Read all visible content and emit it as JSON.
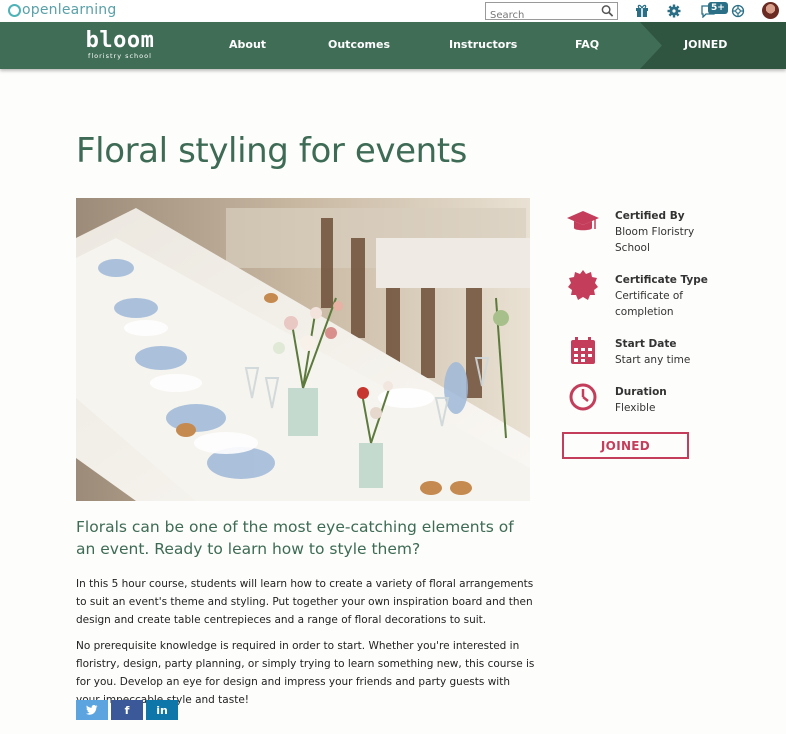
{
  "topbar": {
    "logo_text": "openlearning",
    "search_placeholder": "Search",
    "notifications_badge": "5+",
    "icons": [
      "gift-icon",
      "gear-icon",
      "chat-icon",
      "help-icon",
      "avatar"
    ]
  },
  "nav": {
    "brand_name": "bloom",
    "brand_sub": "floristry school",
    "items": [
      {
        "label": "About"
      },
      {
        "label": "Outcomes"
      },
      {
        "label": "Instructors"
      },
      {
        "label": "FAQ"
      }
    ],
    "joined_label": "JOINED"
  },
  "main": {
    "title": "Floral styling for events",
    "intro": "Florals can be one of the most eye-catching elements of an event. Ready to learn how to style them?",
    "paragraph1": "In this 5 hour course, students will learn how to create a variety of floral arrangements to suit an event's theme and styling. Put together your own inspiration board and then design and create table centrepieces and a range of floral decorations to suit.",
    "paragraph2": "No prerequisite knowledge is required in order to start. Whether you're interested in floristry, design, party planning, or simply trying to learn something new, this course is for you.  Develop an eye for design and impress your friends and party guests with your impeccable style and taste!",
    "share": [
      {
        "icon": "twitter-icon",
        "color": "#5ba4e0"
      },
      {
        "label": "f",
        "icon": "facebook-icon",
        "color": "#3b5998"
      },
      {
        "label": "in",
        "icon": "linkedin-icon",
        "color": "#0e76a8"
      }
    ]
  },
  "sidebar": {
    "facts": [
      {
        "label": "Certified By",
        "value": "Bloom Floristry School",
        "icon": "graduation-cap-icon"
      },
      {
        "label": "Certificate Type",
        "value": "Certificate of completion",
        "icon": "certificate-seal-icon"
      },
      {
        "label": "Start Date",
        "value": "Start any time",
        "icon": "calendar-icon"
      },
      {
        "label": "Duration",
        "value": "Flexible",
        "icon": "clock-icon"
      }
    ],
    "joined_button": "JOINED"
  },
  "colors": {
    "brand_green": "#3f6d55",
    "accent_pink": "#c43e5c",
    "teal": "#4db3b7"
  }
}
